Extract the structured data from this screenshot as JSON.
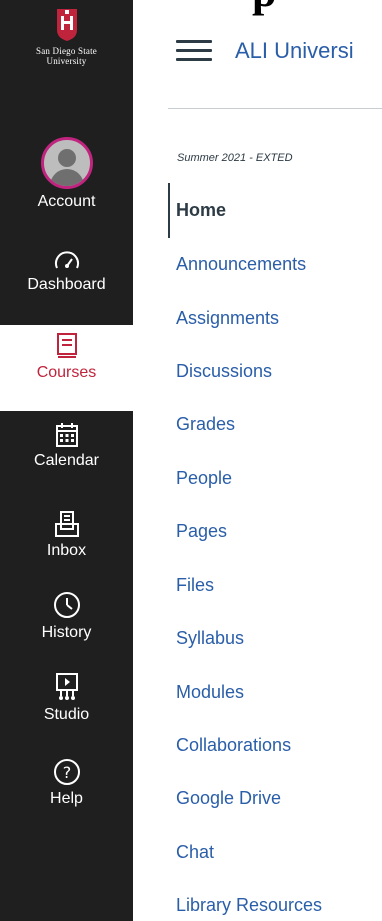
{
  "page": {
    "top_partial_text": "p"
  },
  "global_nav": {
    "logo": {
      "line1": "San Diego State",
      "line2": "University"
    },
    "items": [
      {
        "label": "Account",
        "icon": "avatar"
      },
      {
        "label": "Dashboard",
        "icon": "dashboard-icon"
      },
      {
        "label": "Courses",
        "icon": "courses-icon",
        "active": true
      },
      {
        "label": "Calendar",
        "icon": "calendar-icon"
      },
      {
        "label": "Inbox",
        "icon": "inbox-icon"
      },
      {
        "label": "History",
        "icon": "history-icon"
      },
      {
        "label": "Studio",
        "icon": "studio-icon"
      },
      {
        "label": "Help",
        "icon": "help-icon"
      }
    ],
    "colors": {
      "background": "#1f1f1f",
      "active": "#c0243c",
      "avatar_ring": "#c0247f"
    }
  },
  "course_header": {
    "breadcrumb": "ALI Universi"
  },
  "course_nav": {
    "term": "Summer 2021 - EXTED",
    "items": [
      {
        "label": "Home",
        "active": true
      },
      {
        "label": "Announcements"
      },
      {
        "label": "Assignments"
      },
      {
        "label": "Discussions"
      },
      {
        "label": "Grades"
      },
      {
        "label": "People"
      },
      {
        "label": "Pages"
      },
      {
        "label": "Files"
      },
      {
        "label": "Syllabus"
      },
      {
        "label": "Modules"
      },
      {
        "label": "Collaborations"
      },
      {
        "label": "Google Drive"
      },
      {
        "label": "Chat"
      },
      {
        "label": "Library Resources"
      }
    ],
    "colors": {
      "link": "#2a5ea8",
      "active_text": "#2d3b45"
    }
  }
}
